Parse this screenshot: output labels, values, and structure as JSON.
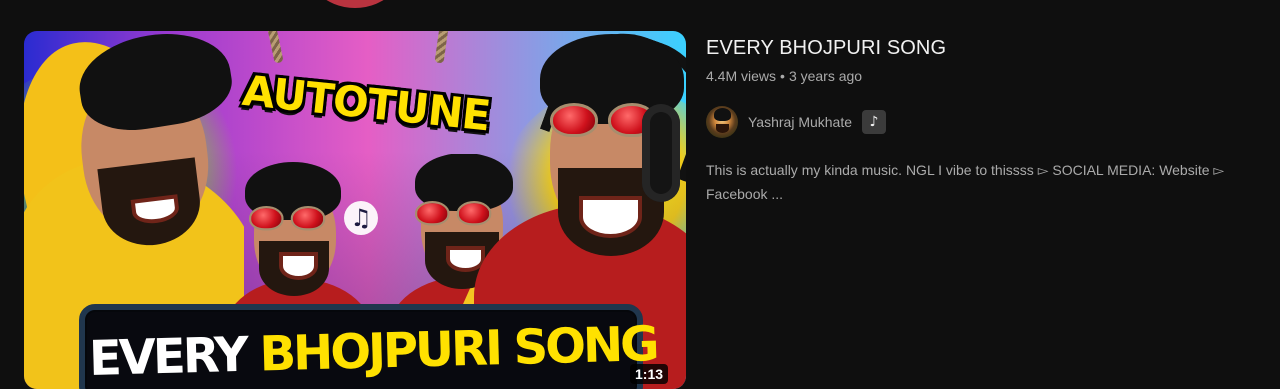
{
  "video": {
    "title": "EVERY BHOJPURI SONG",
    "views": "4.4M views",
    "separator": "•",
    "age": "3 years ago",
    "duration": "1:13",
    "thumbnail": {
      "top_text": "AUTOTUNE",
      "title_white": "EVERY",
      "title_yellow": "BHOJPURI SONG",
      "music_glyph": "♫"
    },
    "description_line_1": "This is actually my kinda music. NGL I vibe to thissss ▻ SOCIAL MEDIA: Website ▻",
    "description_line_2": "Facebook ..."
  },
  "channel": {
    "name": "Yashraj Mukhate",
    "avatar_icon": "channel-avatar",
    "badge_icon": "official-artist-music-note-icon",
    "badge_glyph": "♪"
  },
  "colors": {
    "background": "#0f0f0f",
    "primary_text": "#f1f1f1",
    "secondary_text": "#aaaaaa",
    "thumbnail_yellow": "#ffe100",
    "shirt_red": "#b71d1e"
  }
}
